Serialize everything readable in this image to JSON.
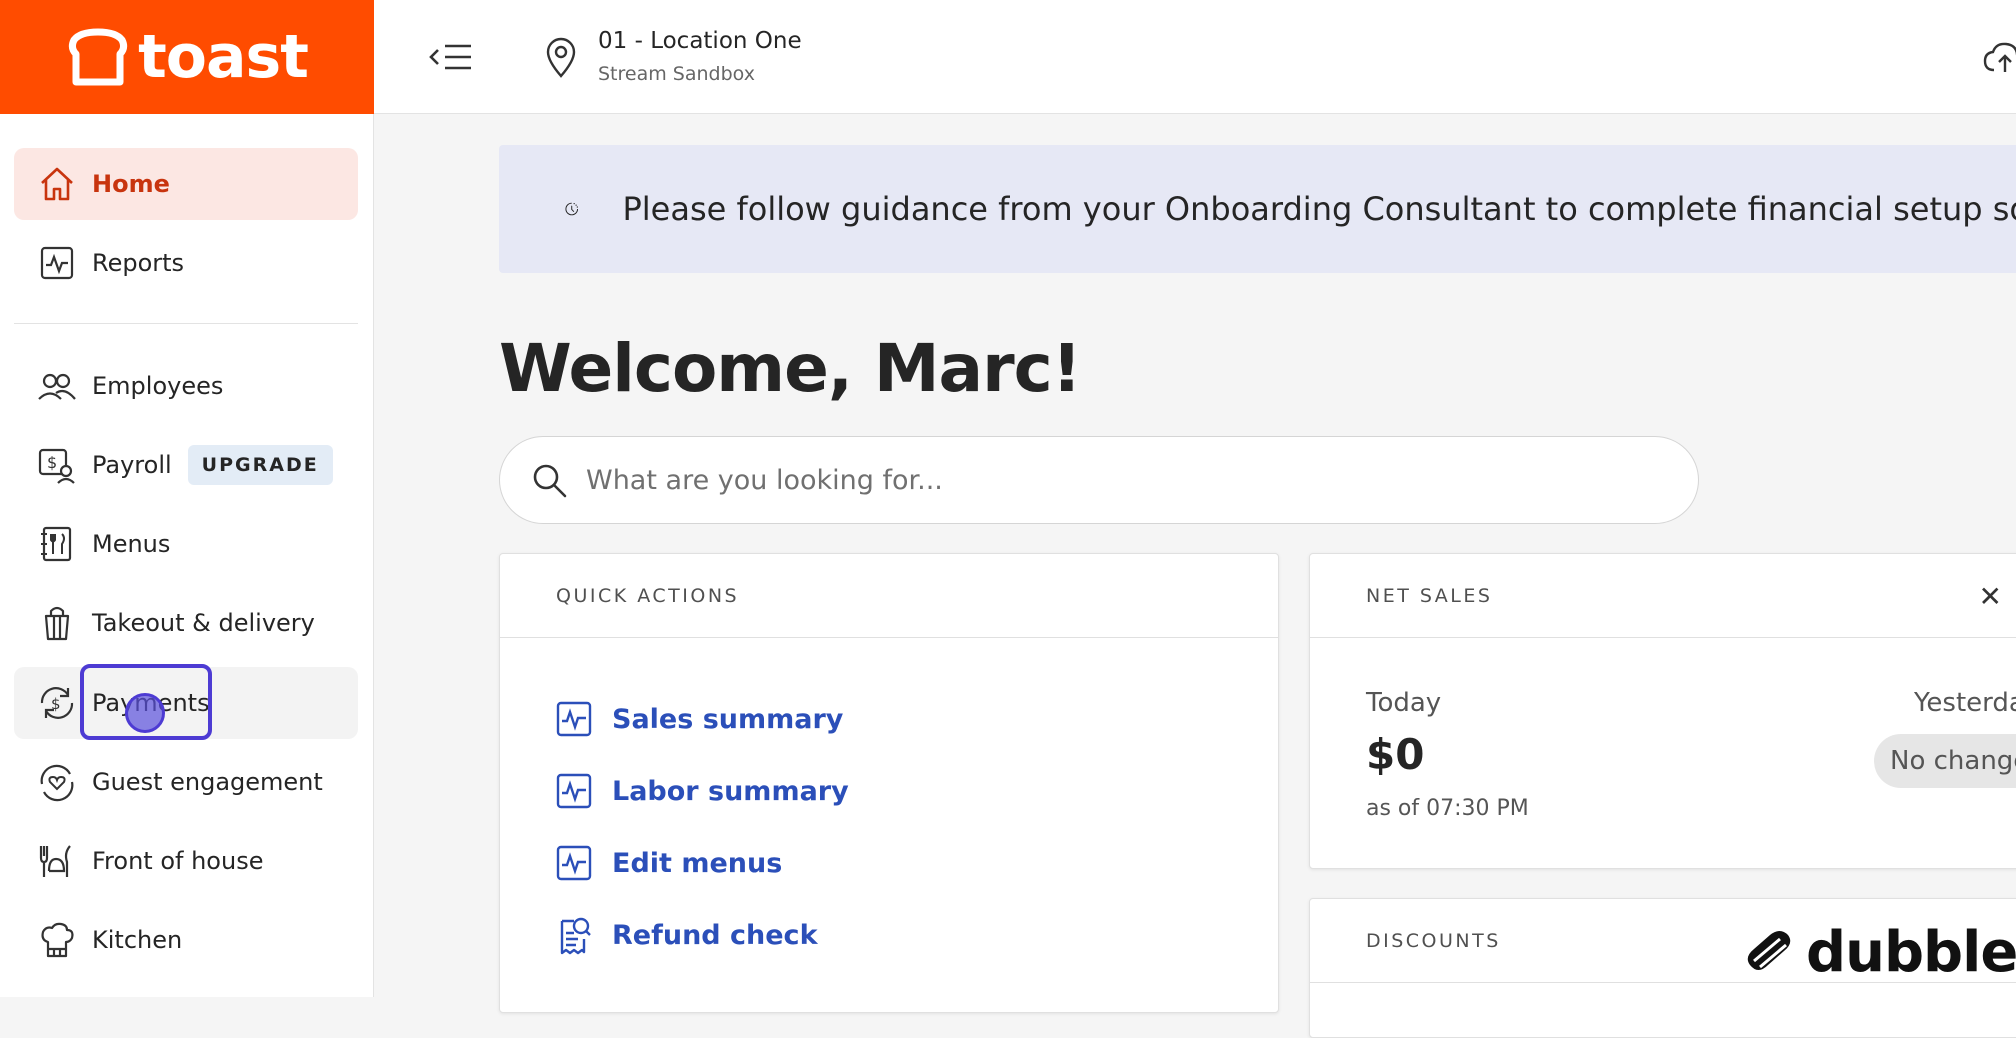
{
  "brand": {
    "name": "toast",
    "color": "#ff4c00"
  },
  "header": {
    "location_name": "01 - Location One",
    "location_sub": "Stream Sandbox"
  },
  "sidebar": {
    "items": [
      {
        "label": "Home",
        "icon": "home-icon",
        "active": true
      },
      {
        "label": "Reports",
        "icon": "reports-icon"
      },
      {
        "label": "Employees",
        "icon": "employees-icon"
      },
      {
        "label": "Payroll",
        "icon": "payroll-icon",
        "badge": "UPGRADE"
      },
      {
        "label": "Menus",
        "icon": "menus-icon"
      },
      {
        "label": "Takeout & delivery",
        "icon": "takeout-icon"
      },
      {
        "label": "Payments",
        "icon": "payments-icon",
        "hover": true
      },
      {
        "label": "Guest engagement",
        "icon": "guest-engagement-icon"
      },
      {
        "label": "Front of house",
        "icon": "front-of-house-icon"
      },
      {
        "label": "Kitchen",
        "icon": "kitchen-icon"
      }
    ]
  },
  "banner": {
    "text": "Please follow guidance from your Onboarding Consultant to complete financial setup so"
  },
  "main": {
    "welcome": "Welcome, Marc!",
    "search_placeholder": "What are you looking for..."
  },
  "quick_actions": {
    "title": "QUICK ACTIONS",
    "items": [
      {
        "label": "Sales summary",
        "icon": "chart-icon"
      },
      {
        "label": "Labor summary",
        "icon": "chart-icon"
      },
      {
        "label": "Edit menus",
        "icon": "chart-icon"
      },
      {
        "label": "Refund check",
        "icon": "receipt-search-icon"
      }
    ]
  },
  "net_sales": {
    "title": "NET SALES",
    "today_label": "Today",
    "today_value": "$0",
    "as_of": "as of 07:30 PM",
    "yesterday_label": "Yesterda",
    "change_badge": "No change"
  },
  "discounts": {
    "title": "DISCOUNTS"
  },
  "watermark": {
    "text": "dubble"
  },
  "colors": {
    "accent": "#ff4c00",
    "link": "#2b4fb9",
    "active_bg": "#fce7e3",
    "highlight": "#4d3bd3"
  }
}
